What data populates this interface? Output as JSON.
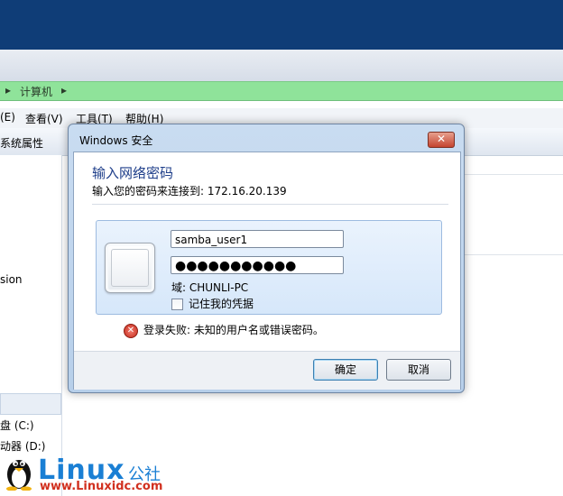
{
  "explorer": {
    "address": {
      "segment": "计算机"
    },
    "menu": [
      "(E)",
      "查看(V)",
      "工具(T)",
      "帮助(H)"
    ],
    "toolbar_item": "系统属性",
    "left_pane": {
      "item_1": "sion",
      "drive_c": "盘 (C:)",
      "drive_d": "动器 (D:)"
    }
  },
  "dialog": {
    "title": "Windows 安全",
    "close_label": "✕",
    "heading": "输入网络密码",
    "subtext": "输入您的密码来连接到: 172.16.20.139",
    "username": "samba_user1",
    "password_mask": "●●●●●●●●●●●",
    "domain": "域: CHUNLI-PC",
    "remember_label": "记住我的凭据",
    "error_icon": "✕",
    "error_text": "登录失败: 未知的用户名或错误密码。",
    "ok_label": "确定",
    "cancel_label": "取消"
  },
  "watermark": {
    "logo": "Linux",
    "logo_suffix": "公社",
    "url": "www.Linuxidc.com"
  }
}
